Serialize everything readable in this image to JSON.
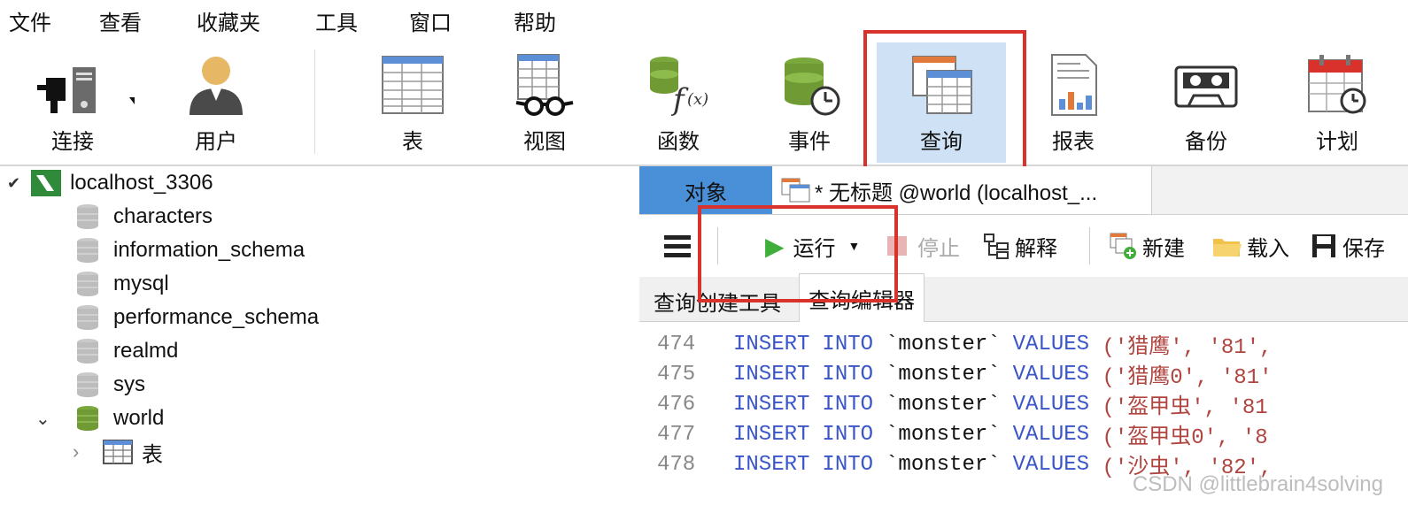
{
  "menu": [
    "文件",
    "查看",
    "收藏夹",
    "工具",
    "窗口",
    "帮助"
  ],
  "toolbar": {
    "connect": "连接",
    "user": "用户",
    "table": "表",
    "view": "视图",
    "function": "函数",
    "event": "事件",
    "query": "查询",
    "report": "报表",
    "backup": "备份",
    "schedule": "计划"
  },
  "tree": {
    "connection": "localhost_3306",
    "databases": [
      "characters",
      "information_schema",
      "mysql",
      "performance_schema",
      "realmd",
      "sys",
      "world"
    ],
    "child": "表"
  },
  "tabs": {
    "objects": "对象",
    "doc": "* 无标题 @world (localhost_..."
  },
  "query_toolbar": {
    "run": "运行",
    "stop": "停止",
    "explain": "解释",
    "new": "新建",
    "load": "载入",
    "save": "保存"
  },
  "subtabs": {
    "builder": "查询创建工具",
    "editor": "查询编辑器"
  },
  "code": [
    {
      "ln": "474",
      "kw1": "INSERT",
      "kw2": "INTO",
      "tbl": "`monster`",
      "kw3": "VALUES",
      "rest": " ('猎鹰', '81',"
    },
    {
      "ln": "475",
      "kw1": "INSERT",
      "kw2": "INTO",
      "tbl": "`monster`",
      "kw3": "VALUES",
      "rest": " ('猎鹰0', '81'"
    },
    {
      "ln": "476",
      "kw1": "INSERT",
      "kw2": "INTO",
      "tbl": "`monster`",
      "kw3": "VALUES",
      "rest": " ('盔甲虫', '81"
    },
    {
      "ln": "477",
      "kw1": "INSERT",
      "kw2": "INTO",
      "tbl": "`monster`",
      "kw3": "VALUES",
      "rest": " ('盔甲虫0', '8"
    },
    {
      "ln": "478",
      "kw1": "INSERT",
      "kw2": "INTO",
      "tbl": "`monster`",
      "kw3": "VALUES",
      "rest": " ('沙虫', '82',"
    }
  ],
  "watermark": "CSDN @littlebrain4solving",
  "colors": {
    "highlight": "#d9322c",
    "active_tab": "#4a90d9",
    "keyword": "#3a55c8",
    "string": "#b0443f"
  }
}
